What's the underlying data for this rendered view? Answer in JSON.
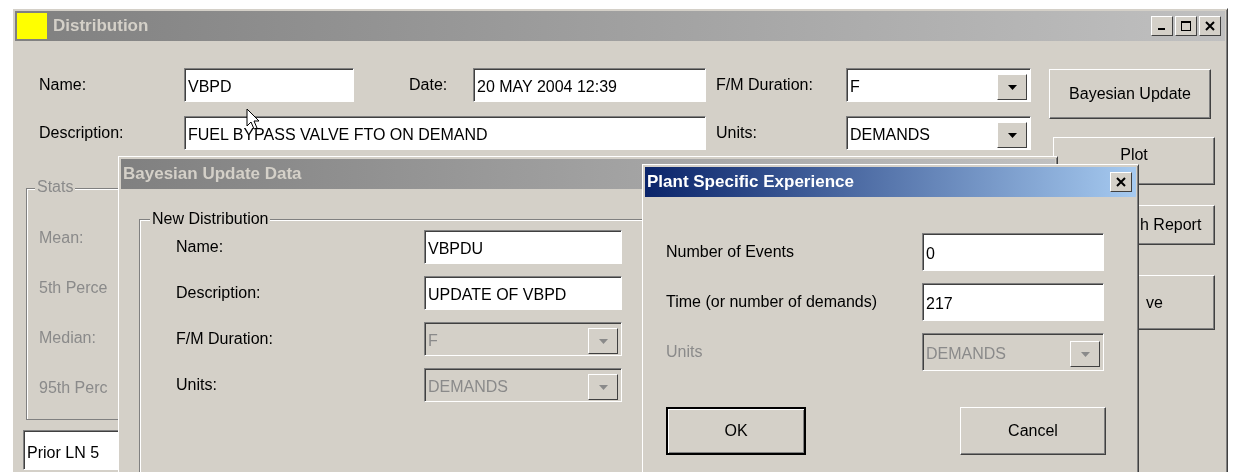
{
  "distribution": {
    "title": "Distribution",
    "active": false,
    "fields": [
      {
        "kind": "text",
        "label": "Name:",
        "value": "VBPD"
      },
      {
        "kind": "text",
        "label": "Date:",
        "value": "20 MAY 2004 12:39"
      },
      {
        "kind": "combo",
        "label": "F/M Duration:",
        "value": "F"
      },
      {
        "kind": "text",
        "label": "Description:",
        "value": "FUEL BYPASS VALVE FTO ON DEMAND"
      },
      {
        "kind": "combo",
        "label": "Units:",
        "value": "DEMANDS"
      }
    ],
    "stats": {
      "legend": "Stats",
      "disabled": true,
      "labels": [
        "Mean:",
        "5th Perce",
        "Median:",
        "95th Perc"
      ]
    },
    "prior_field": {
      "value": "Prior LN 5"
    },
    "buttons": [
      "Bayesian Update",
      "Plot",
      "h Report",
      "ve"
    ]
  },
  "bayesian_dialog": {
    "title": "Bayesian Update Data",
    "active": false,
    "group": "New Distribution",
    "rows": [
      {
        "kind": "text",
        "label": "Name:",
        "value": "VBPDU",
        "disabled": false
      },
      {
        "kind": "text",
        "label": "Description:",
        "value": "UPDATE OF VBPD",
        "disabled": false
      },
      {
        "kind": "combo",
        "label": "F/M Duration:",
        "value": "F",
        "disabled": true
      },
      {
        "kind": "combo",
        "label": "Units:",
        "value": "DEMANDS",
        "disabled": true
      }
    ]
  },
  "plant_dialog": {
    "title": "Plant Specific Experience",
    "active": true,
    "rows": [
      {
        "kind": "text",
        "label": "Number of Events",
        "value": "0",
        "disabled": false
      },
      {
        "kind": "text",
        "label": "Time (or number of demands)",
        "value": "217",
        "disabled": false
      },
      {
        "kind": "combo",
        "label": "Units",
        "value": "DEMANDS",
        "disabled": true
      }
    ],
    "buttons": [
      {
        "label": "OK",
        "default": true
      },
      {
        "label": "Cancel",
        "default": false
      }
    ]
  }
}
